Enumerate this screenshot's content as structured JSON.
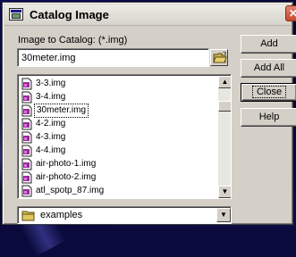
{
  "window": {
    "title": "Catalog Image",
    "close_label": "✕"
  },
  "form": {
    "image_label": "Image to Catalog: (*.img)",
    "file_value": "30meter.img"
  },
  "file_list": {
    "items": [
      {
        "name": "3-3.img",
        "selected": false
      },
      {
        "name": "3-4.img",
        "selected": false
      },
      {
        "name": "30meter.img",
        "selected": true
      },
      {
        "name": "4-2.img",
        "selected": false
      },
      {
        "name": "4-3.img",
        "selected": false
      },
      {
        "name": "4-4.img",
        "selected": false
      },
      {
        "name": "air-photo-1.img",
        "selected": false
      },
      {
        "name": "air-photo-2.img",
        "selected": false
      },
      {
        "name": "atl_spotp_87.img",
        "selected": false
      }
    ],
    "scroll_up": "▲",
    "scroll_down": "▼"
  },
  "directory": {
    "value": "examples",
    "arrow": "▼"
  },
  "buttons": {
    "add": "Add",
    "add_all": "Add All",
    "close": "Close",
    "help": "Help"
  },
  "colors": {
    "dialog_bg": "#d4d0c8",
    "backdrop": "#0a0a3c",
    "close_red": "#c84a30",
    "file_icon": "#8a2a8a"
  },
  "icons": {
    "title": "catalog-image-icon",
    "folder_open": "open-folder-icon",
    "file": "img-file-icon",
    "directory": "folder-icon"
  }
}
